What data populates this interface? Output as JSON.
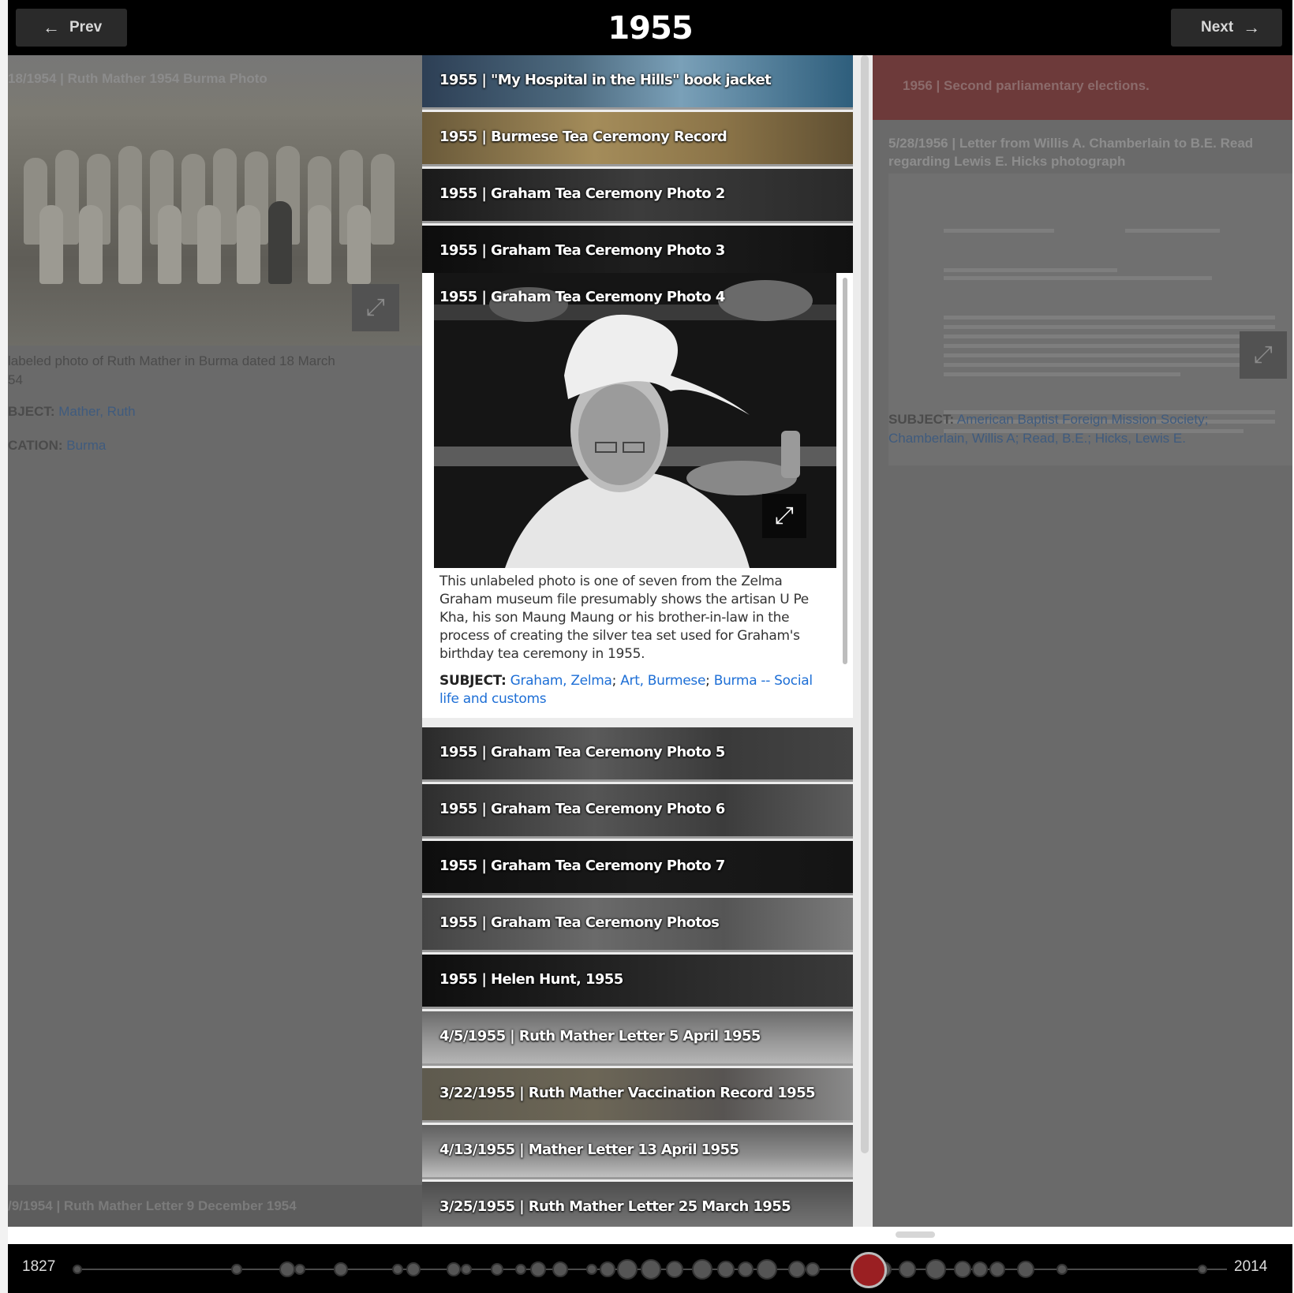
{
  "header": {
    "prev_label": "Prev",
    "next_label": "Next",
    "year": "1955"
  },
  "left_panel": {
    "title": "18/1954 | Ruth Mather 1954 Burma Photo",
    "desc_line1": "labeled photo of Ruth Mather in Burma dated 18 March",
    "desc_line2": "54",
    "subject_label": "BJECT:",
    "subject_value": "Mather, Ruth",
    "location_label": "CATION:",
    "location_value": "Burma",
    "next_item": "/9/1954 | Ruth Mather Letter 9 December 1954"
  },
  "right_panel": {
    "event": "1956 | Second parliamentary elections.",
    "letter_title": "5/28/1956 | Letter from Willis A. Chamberlain to B.E. Read regarding Lewis E. Hicks photograph",
    "subject_label": "SUBJECT:",
    "subject_value": "American Baptist Foreign Mission Society; Chamberlain, Willis A; Read, B.E.; Hicks, Lewis E."
  },
  "center": {
    "items_before": [
      {
        "title": "1955 | \"My Hospital in the Hills\" book jacket"
      },
      {
        "title": "1955 | Burmese Tea Ceremony Record"
      },
      {
        "title": "1955 | Graham Tea Ceremony Photo 2"
      },
      {
        "title": "1955 | Graham Tea Ceremony Photo 3"
      }
    ],
    "expanded": {
      "title": "1955 | Graham Tea Ceremony Photo 4",
      "description": "This unlabeled photo is one of seven from the Zelma Graham museum file presumably shows the artisan U Pe Kha, his son Maung Maung or his brother-in-law in the process of creating the silver tea set used for Graham's birthday tea ceremony in 1955.",
      "subject_label": "SUBJECT:",
      "subjects": [
        "Graham, Zelma",
        "Art, Burmese",
        "Burma -- Social life and customs"
      ]
    },
    "items_after": [
      {
        "title": "1955 | Graham Tea Ceremony Photo 5"
      },
      {
        "title": "1955 | Graham Tea Ceremony Photo 6"
      },
      {
        "title": "1955 | Graham Tea Ceremony Photo 7"
      },
      {
        "title": "1955 | Graham Tea Ceremony Photos"
      },
      {
        "title": "1955 | Helen Hunt, 1955"
      },
      {
        "title": "4/5/1955 | Ruth Mather Letter 5 April 1955"
      },
      {
        "title": "3/22/1955 | Ruth Mather Vaccination Record 1955"
      },
      {
        "title": "4/13/1955 | Mather Letter 13 April 1955"
      },
      {
        "title": "3/25/1955 | Ruth Mather Letter 25 March 1955"
      }
    ]
  },
  "timeline": {
    "start": "1827",
    "end": "2014",
    "current": "1955"
  },
  "colors": {
    "accent": "#9a1f22",
    "link": "#1e6fd6",
    "header_bg": "#000000",
    "event_bg": "#6d3a3a"
  },
  "icons": [
    "arrow-left-icon",
    "arrow-right-icon",
    "expand-icon"
  ]
}
